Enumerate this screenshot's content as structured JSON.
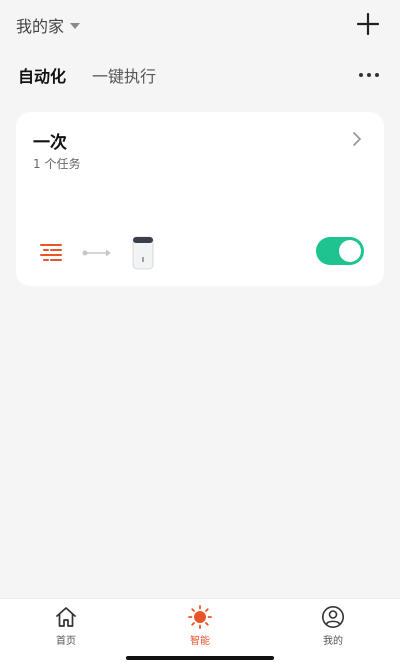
{
  "header": {
    "home_name": "我的家",
    "add_icon": "plus-icon"
  },
  "tabs": [
    {
      "label": "自动化",
      "active": true
    },
    {
      "label": "一键执行",
      "active": false
    }
  ],
  "more_icon": "more-dots-icon",
  "card": {
    "title": "一次",
    "subtitle": "1 个任务",
    "enabled": true,
    "toggle_color": "#1fc38f",
    "trigger_icon": "schedule-list-icon",
    "device_icon": "dehumidifier-icon"
  },
  "bottom_nav": [
    {
      "label": "首页",
      "icon": "home-icon",
      "active": false
    },
    {
      "label": "智能",
      "icon": "smart-sun-icon",
      "active": true
    },
    {
      "label": "我的",
      "icon": "profile-icon",
      "active": false
    }
  ],
  "colors": {
    "accent": "#e8552b",
    "background": "#f5f5f5"
  }
}
